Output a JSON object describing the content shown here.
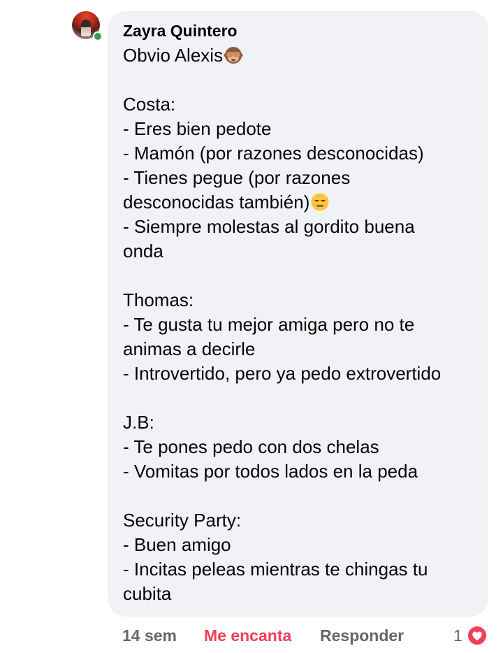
{
  "comment": {
    "author": "Zayra Quintero",
    "lines": [
      {
        "text": "Obvio Alexis",
        "emoji": "see-no-evil-monkey"
      },
      {
        "text": ""
      },
      {
        "text": "Costa:"
      },
      {
        "text": "- Eres bien pedote"
      },
      {
        "text": "- Mamón (por razones desconocidas)"
      },
      {
        "text": "- Tienes pegue (por razones"
      },
      {
        "text": "desconocidas también)",
        "emoji": "expressionless-face"
      },
      {
        "text": "- Siempre molestas al gordito buena"
      },
      {
        "text": "onda"
      },
      {
        "text": ""
      },
      {
        "text": "Thomas:"
      },
      {
        "text": "- Te gusta tu mejor amiga pero no te"
      },
      {
        "text": "animas a decirle"
      },
      {
        "text": "- Introvertido, pero ya pedo extrovertido"
      },
      {
        "text": ""
      },
      {
        "text": "J.B:"
      },
      {
        "text": "- Te pones pedo con dos chelas"
      },
      {
        "text": "- Vomitas por todos lados en la peda"
      },
      {
        "text": ""
      },
      {
        "text": "Security Party:"
      },
      {
        "text": "- Buen amigo"
      },
      {
        "text": "- Incitas peleas mientras te chingas tu"
      },
      {
        "text": "cubita"
      }
    ]
  },
  "actions": {
    "time": "14 sem",
    "love": "Me encanta",
    "reply": "Responder",
    "reaction_count": "1",
    "reaction_icon": "heart-icon"
  },
  "colors": {
    "bubble": "#f0f2f5",
    "love_red": "#f33e58",
    "meta_gray": "#65676b",
    "online_green": "#31a24c"
  }
}
